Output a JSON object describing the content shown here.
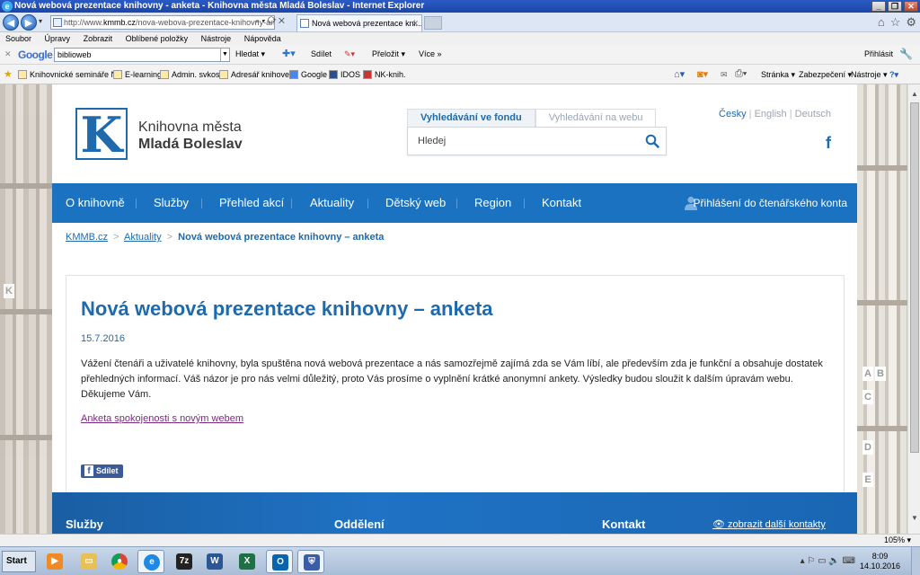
{
  "window": {
    "title": "Nová webová prezentace knihovny - anketa - Knihovna města Mladá Boleslav - Internet Explorer",
    "controls": {
      "minimize": "_",
      "restore": "❐",
      "close": "✕"
    }
  },
  "address_bar": {
    "url_prefix": "http://www.",
    "url_domain": "kmmb.cz",
    "url_rest": "/nova-webova-prezentace-knihovny-ank",
    "tools": "⌕ ▾ ⟳ ✕"
  },
  "tab": {
    "title": "Nová webová prezentace kni...",
    "close": "✕"
  },
  "menu": [
    "Soubor",
    "Úpravy",
    "Zobrazit",
    "Oblíbené položky",
    "Nástroje",
    "Nápověda"
  ],
  "google_toolbar": {
    "close": "✕",
    "logo": "Google",
    "search_value": "biblioweb",
    "search_btn": "Hledat ▾",
    "share": "Sdílet",
    "translate": "Přeložit ▾",
    "more": "Více »",
    "signin": "Přihlásit"
  },
  "favorites": {
    "items": [
      "Knihovnické semináře NK",
      "E-learning",
      "Admin. svkos",
      "Adresář knihoven",
      "Google",
      "IDOS",
      "NK-knih."
    ],
    "commands": [
      "Stránka ▾",
      "Zabezpečení ▾",
      "Nástroje ▾",
      "?▾"
    ]
  },
  "site": {
    "logo_letter": "K",
    "logo_line1": "Knihovna města",
    "logo_line2": "Mladá Boleslav",
    "search_tabs": [
      "Vyhledávání ve fondu",
      "Vyhledávání na webu"
    ],
    "search_placeholder": "Hledej",
    "languages": [
      "Česky",
      "English",
      "Deutsch"
    ],
    "facebook": "f",
    "nav": [
      "O knihovně",
      "Služby",
      "Přehled akcí",
      "Aktuality",
      "Dětský web",
      "Region",
      "Kontakt"
    ],
    "login": "Přihlášení do čtenářského konta",
    "breadcrumb": [
      "KMMB.cz",
      "Aktuality",
      "Nová webová prezentace knihovny – anketa"
    ],
    "breadcrumb_sep": ">",
    "article": {
      "title": "Nová webová prezentace knihovny – anketa",
      "date": "15.7.2016",
      "body": "Vážení čtenáři a uživatelé knihovny, byla spuštěna nová webová prezentace a nás samozřejmě zajímá zda se Vám líbí, ale především zda je funkční a obsahuje dostatek přehledných informací. Váš názor je pro nás velmi důležitý, proto Vás prosíme o vyplnění krátké anonymní ankety. Výsledky budou sloužit k dalším úpravám webu. Děkujeme Vám.",
      "survey_link": "Anketa spokojenosti s novým webem",
      "share": "Sdílet"
    },
    "footer": {
      "col1": "Služby",
      "col2": "Oddělení",
      "col3": "Kontakt",
      "more_contacts": "zobrazit další kontakty"
    }
  },
  "status": {
    "zoom": "105% ▾"
  },
  "taskbar": {
    "start": "Start",
    "apps": [
      "media",
      "explorer",
      "chrome",
      "ie",
      "7z",
      "word",
      "excel",
      "outlook",
      "security"
    ],
    "time": "8:09",
    "date": "14.10.2016"
  },
  "colors": {
    "brand_blue": "#1a72c0",
    "link_blue": "#1f6aad",
    "visited_purple": "#7a2a7f"
  }
}
